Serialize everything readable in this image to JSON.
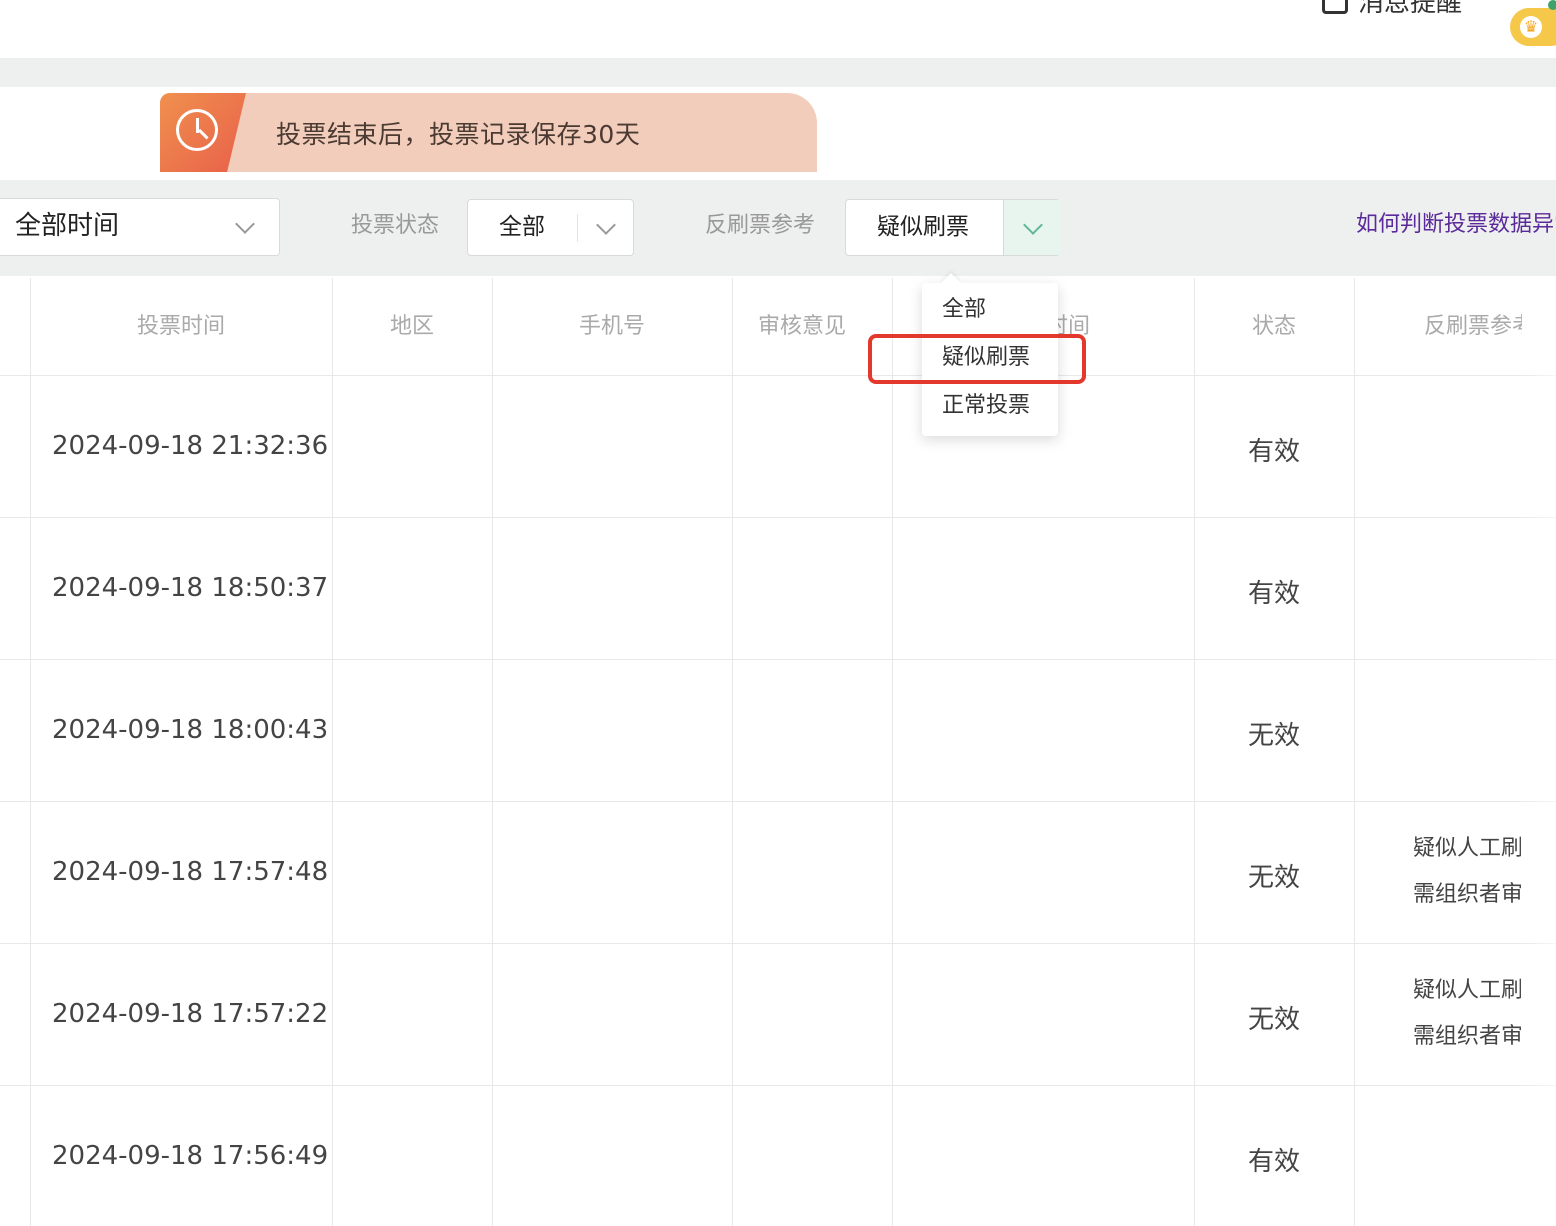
{
  "header": {
    "notify_label": "消息提醒"
  },
  "banner": {
    "text": "投票结束后，投票记录保存30天"
  },
  "filters": {
    "time_select": "全部时间",
    "vote_status_label": "投票状态",
    "vote_status_value": "全部",
    "anti_fraud_label": "反刷票参考",
    "anti_fraud_value": "疑似刷票",
    "help_link": "如何判断投票数据异常"
  },
  "dropdown": {
    "options": [
      "全部",
      "疑似刷票",
      "正常投票"
    ],
    "highlighted": "疑似刷票"
  },
  "table": {
    "columns": [
      "投票时间",
      "地区",
      "手机号",
      "审核意见",
      "时间",
      "状态",
      "反刷票参考"
    ],
    "rows": [
      {
        "time": "2024-09-18 21:32:36",
        "status": "有效",
        "ref1": "",
        "ref2": ""
      },
      {
        "time": "2024-09-18 18:50:37",
        "status": "有效",
        "ref1": "",
        "ref2": ""
      },
      {
        "time": "2024-09-18 18:00:43",
        "status": "无效",
        "ref1": "",
        "ref2": ""
      },
      {
        "time": "2024-09-18 17:57:48",
        "status": "无效",
        "ref1": "疑似人工刷票",
        "ref2": "需组织者审核"
      },
      {
        "time": "2024-09-18 17:57:22",
        "status": "无效",
        "ref1": "疑似人工刷票",
        "ref2": "需组织者审核"
      },
      {
        "time": "2024-09-18 17:56:49",
        "status": "有效",
        "ref1": "",
        "ref2": ""
      }
    ]
  },
  "colors": {
    "accent_link": "#5b2a9a",
    "highlight_box": "#e3392c",
    "banner_bg": "#f2cdbb",
    "banner_icon": "#e8604a"
  }
}
